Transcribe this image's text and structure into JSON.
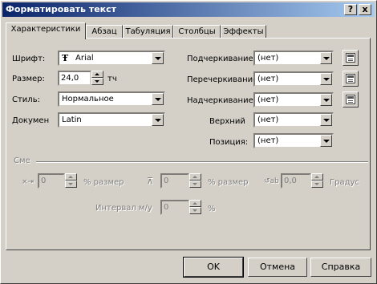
{
  "window": {
    "title": "Форматировать текст",
    "help_btn": "?",
    "close_btn": "x"
  },
  "tabs": [
    "Характеристики",
    "Абзац",
    "Табуляция",
    "Столбцы",
    "Эффекты"
  ],
  "left": {
    "font_label": "Шрифт:",
    "font_value": "Arial",
    "size_label": "Размер:",
    "size_value": "24,0",
    "size_unit": "тч",
    "style_label": "Стиль:",
    "style_value": "Нормальное",
    "doc_label": "Докумен",
    "doc_value": "Latin"
  },
  "right": {
    "underline_label": "Подчеркивание:",
    "underline_value": "(нет)",
    "strike_label": "Перечеркивание",
    "strike_value": "(нет)",
    "overline_label": "Надчеркивание:",
    "overline_value": "(нет)",
    "upper_label": "Верхний",
    "upper_value": "(нет)",
    "position_label": "Позиция:",
    "position_value": "(нет)"
  },
  "shift": {
    "group_label": "Сме",
    "h_value": "0",
    "h_unit": "% размер",
    "v_value": "0",
    "v_unit": "% размер",
    "angle_value": "0,0",
    "angle_unit": "Градус",
    "interval_label": "Интервал м/у",
    "interval_value": "0",
    "interval_unit": "%"
  },
  "buttons": {
    "ok": "OK",
    "cancel": "Отмена",
    "help": "Справка"
  },
  "icons": {
    "font_type": "truetype-icon",
    "edit": "edit-icon"
  }
}
